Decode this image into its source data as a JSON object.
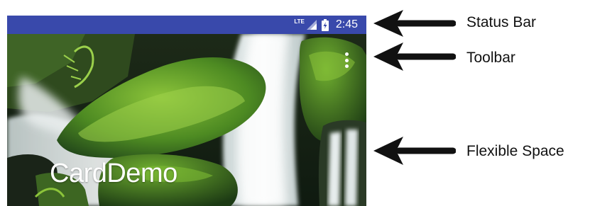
{
  "status_bar": {
    "network": "LTE",
    "time": "2:45",
    "background": "#3949ab"
  },
  "toolbar": {
    "menu_icon": "overflow-menu-icon"
  },
  "flexible_space": {
    "title": "CardDemo",
    "image": "waterfall-mossy-rocks"
  },
  "annotations": [
    {
      "label": "Status Bar",
      "target": "status-bar"
    },
    {
      "label": "Toolbar",
      "target": "toolbar"
    },
    {
      "label": "Flexible Space",
      "target": "flexible-space"
    }
  ]
}
